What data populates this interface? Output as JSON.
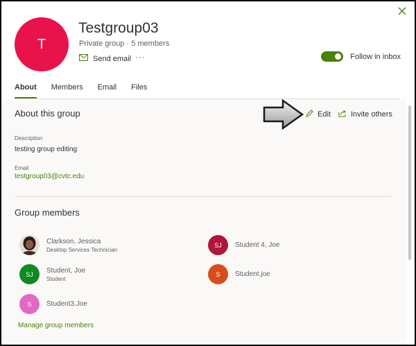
{
  "header": {
    "avatar_initial": "T",
    "title": "Testgroup03",
    "subtitle": "Private group · 5 members",
    "send_email_label": "Send email",
    "more_label": "···",
    "follow_label": "Follow in inbox",
    "follow_enabled": true
  },
  "tabs": [
    {
      "label": "About",
      "active": true
    },
    {
      "label": "Members",
      "active": false
    },
    {
      "label": "Email",
      "active": false
    },
    {
      "label": "Files",
      "active": false
    }
  ],
  "about": {
    "section_title": "About this group",
    "edit_label": "Edit",
    "invite_label": "Invite others",
    "description_label": "Description",
    "description_value": "testing group editing",
    "email_label": "Email",
    "email_value": "testgroup03@cvtc.edu"
  },
  "members_section": {
    "title": "Group members",
    "members": [
      {
        "name": "Clarkson, Jessica",
        "title": "Desktop Services Technician",
        "initials": "",
        "color": "#5a4034",
        "photo": true
      },
      {
        "name": "Student, Joe",
        "title": "Student",
        "initials": "SJ",
        "color": "#0f8a1f"
      },
      {
        "name": "Student3.Joe",
        "title": "",
        "initials": "S",
        "color": "#e468c3"
      },
      {
        "name": "Student 4, Joe",
        "title": "",
        "initials": "SJ",
        "color": "#b0153c"
      },
      {
        "name": "Student.joe",
        "title": "",
        "initials": "S",
        "color": "#d64e1c"
      }
    ],
    "manage_label": "Manage group members"
  },
  "colors": {
    "accent": "#498205",
    "group_avatar": "#e8134a"
  }
}
